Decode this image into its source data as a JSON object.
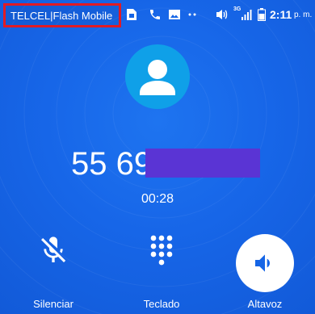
{
  "status_bar": {
    "carrier": "TELCEL|Flash Mobile",
    "network": "3G",
    "time": "2:11",
    "am_pm": "p. m.",
    "icons": [
      "sim-icon",
      "phone-icon",
      "image-icon",
      "dots-icon",
      "vibrate-icon",
      "signal-icon",
      "battery-icon"
    ]
  },
  "call": {
    "number_visible": "55 69",
    "timer": "00:28"
  },
  "controls": {
    "mute_label": "Silenciar",
    "keypad_label": "Teclado",
    "speaker_label": "Altavoz"
  },
  "colors": {
    "background": "#1565e6",
    "avatar": "#0fa0e8",
    "highlight_box": "#e11b24",
    "redaction": "#5a34d4",
    "speaker_active_bg": "#ffffff",
    "speaker_icon": "#1565e6"
  }
}
